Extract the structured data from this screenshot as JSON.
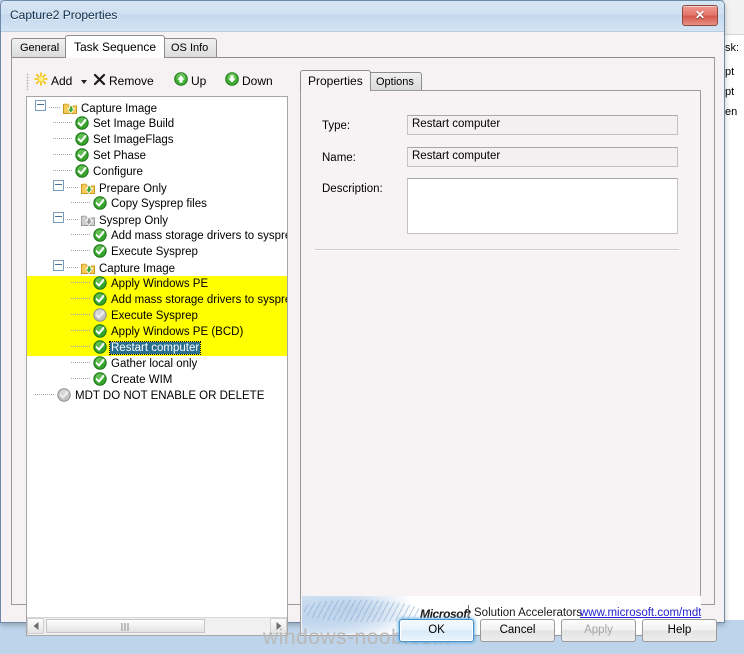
{
  "window": {
    "title": "Capture2 Properties",
    "close_label": "✕"
  },
  "tabs": [
    {
      "label": "General",
      "active": false
    },
    {
      "label": "Task Sequence",
      "active": true
    },
    {
      "label": "OS Info",
      "active": false
    }
  ],
  "toolbar": {
    "add_label": "Add",
    "add_icon": "yellow-star-icon",
    "remove_label": "Remove",
    "remove_icon": "x-icon",
    "up_label": "Up",
    "up_icon": "green-up-arrow-icon",
    "down_label": "Down",
    "down_icon": "green-down-arrow-icon"
  },
  "tree": {
    "nodes": [
      {
        "label": "Capture Image",
        "depth": 0,
        "icon": "folder-enabled-icon",
        "expander": true,
        "highlight": false,
        "selected": false
      },
      {
        "label": "Set Image Build",
        "depth": 1,
        "icon": "check-enabled-icon",
        "expander": false,
        "highlight": false,
        "selected": false
      },
      {
        "label": "Set ImageFlags",
        "depth": 1,
        "icon": "check-enabled-icon",
        "expander": false,
        "highlight": false,
        "selected": false
      },
      {
        "label": "Set Phase",
        "depth": 1,
        "icon": "check-enabled-icon",
        "expander": false,
        "highlight": false,
        "selected": false
      },
      {
        "label": "Configure",
        "depth": 1,
        "icon": "check-enabled-icon",
        "expander": false,
        "highlight": false,
        "selected": false
      },
      {
        "label": "Prepare Only",
        "depth": 1,
        "icon": "folder-enabled-icon",
        "expander": true,
        "highlight": false,
        "selected": false
      },
      {
        "label": "Copy Sysprep files",
        "depth": 2,
        "icon": "check-enabled-icon",
        "expander": false,
        "highlight": false,
        "selected": false
      },
      {
        "label": "Sysprep Only",
        "depth": 1,
        "icon": "folder-disabled-icon",
        "expander": true,
        "highlight": false,
        "selected": false
      },
      {
        "label": "Add mass storage drivers to sysprep.i",
        "depth": 2,
        "icon": "check-enabled-icon",
        "expander": false,
        "highlight": false,
        "selected": false
      },
      {
        "label": "Execute Sysprep",
        "depth": 2,
        "icon": "check-enabled-icon",
        "expander": false,
        "highlight": false,
        "selected": false
      },
      {
        "label": "Capture Image",
        "depth": 1,
        "icon": "folder-enabled-icon",
        "expander": true,
        "highlight": false,
        "selected": false
      },
      {
        "label": "Apply Windows PE",
        "depth": 2,
        "icon": "check-enabled-icon",
        "expander": false,
        "highlight": true,
        "selected": false
      },
      {
        "label": "Add mass storage drivers to sysprep.i",
        "depth": 2,
        "icon": "check-enabled-icon",
        "expander": false,
        "highlight": true,
        "selected": false
      },
      {
        "label": "Execute Sysprep",
        "depth": 2,
        "icon": "check-disabled-icon",
        "expander": false,
        "highlight": true,
        "selected": false
      },
      {
        "label": "Apply Windows PE (BCD)",
        "depth": 2,
        "icon": "check-enabled-icon",
        "expander": false,
        "highlight": true,
        "selected": false
      },
      {
        "label": "Restart computer",
        "depth": 2,
        "icon": "check-enabled-icon",
        "expander": false,
        "highlight": true,
        "selected": true
      },
      {
        "label": "Gather local only",
        "depth": 2,
        "icon": "check-enabled-icon",
        "expander": false,
        "highlight": false,
        "selected": false
      },
      {
        "label": "Create WIM",
        "depth": 2,
        "icon": "check-enabled-icon",
        "expander": false,
        "highlight": false,
        "selected": false
      },
      {
        "label": "MDT DO NOT ENABLE OR DELETE",
        "depth": 0,
        "icon": "check-disabled-icon",
        "expander": false,
        "highlight": false,
        "selected": false
      }
    ]
  },
  "details": {
    "tabs": [
      {
        "label": "Properties",
        "active": true
      },
      {
        "label": "Options",
        "active": false
      }
    ],
    "type_label": "Type:",
    "type_value": "Restart computer",
    "name_label": "Name:",
    "name_value": "Restart computer",
    "description_label": "Description:",
    "description_value": ""
  },
  "banner": {
    "brand": "Microsoft",
    "tagline": "Solution Accelerators",
    "link": "www.microsoft.com/mdt"
  },
  "footer_buttons": [
    {
      "label": "OK",
      "state": "default"
    },
    {
      "label": "Cancel",
      "state": "normal"
    },
    {
      "label": "Apply",
      "state": "disabled"
    },
    {
      "label": "Help",
      "state": "normal"
    }
  ],
  "watermark": "windows-noob.com",
  "background_window": {
    "lines": [
      "sk:",
      "pt",
      "pt",
      "en"
    ]
  },
  "colors": {
    "highlight_yellow": "#ffff00",
    "selection_blue": "#2a6e8f",
    "link_blue": "#2222cc",
    "dialog_bg": "#f6f1f3",
    "desktop_blue": "#c4d8ec"
  }
}
